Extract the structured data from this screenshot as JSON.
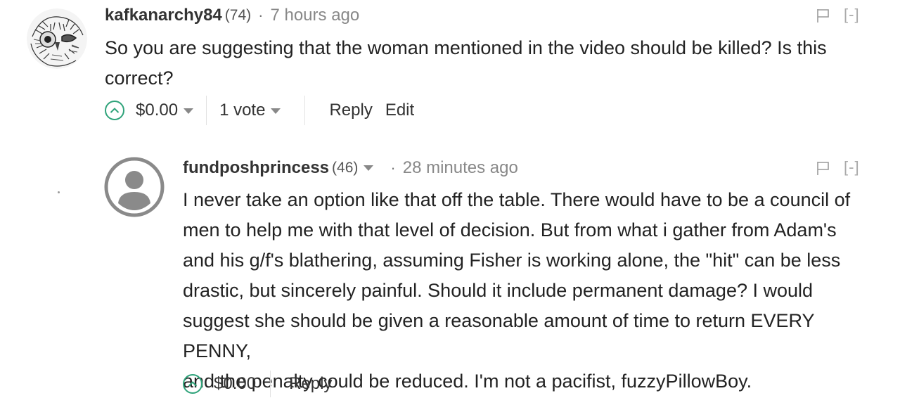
{
  "comments": [
    {
      "author": "kafkanarchy84",
      "reputation": "(74)",
      "separator": "·",
      "time": "7 hours ago",
      "avatar_icon": "owl-sketch-avatar",
      "body_lines": [
        "So you are suggesting that the woman mentioned in the video should be killed? Is this",
        "correct?"
      ],
      "collapse_label": "[-]",
      "payout": "$0.00",
      "votes": "1 vote",
      "reply_label": "Reply",
      "edit_label": "Edit"
    },
    {
      "author": "fundposhprincess",
      "reputation": "(46)",
      "separator": "·",
      "time": "28 minutes ago",
      "avatar_icon": "default-user-avatar",
      "body_lines": [
        "I never take an option like that off the table. There would have to be a council of",
        "men to help me with that level of decision. But from what i gather from Adam's",
        "and his g/f's blathering, assuming Fisher is working alone, the \"hit\" can be less",
        "drastic, but sincerely painful. Should it include permanent damage? I would",
        "suggest she should be given a reasonable amount of time to return EVERY PENNY,",
        "and the penalty could be reduced. I'm not a pacifist, fuzzyPillowBoy."
      ],
      "collapse_label": "[-]",
      "payout": "$0.00",
      "reply_label": "Reply"
    }
  ],
  "colors": {
    "upvote_green": "#2fa37a",
    "text": "#222222",
    "muted": "#888888"
  }
}
